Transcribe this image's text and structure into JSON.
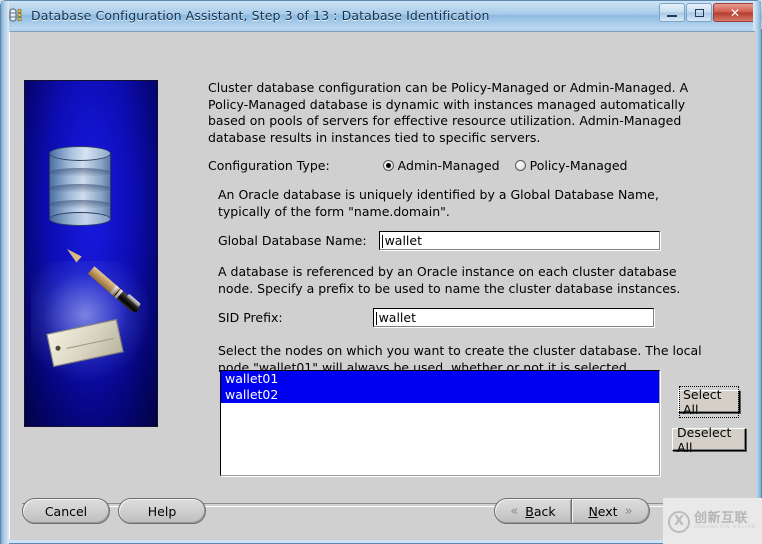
{
  "window": {
    "title": "Database Configuration Assistant, Step 3 of 13 : Database Identification",
    "app_icon": "database-icon",
    "minimize_label": "",
    "maximize_label": "",
    "close_label": "✕"
  },
  "sidebar": {
    "graphic_name": "database-pen-tag-illustration"
  },
  "main": {
    "intro_paragraph": "Cluster database configuration can be Policy-Managed or Admin-Managed. A Policy-Managed database is dynamic with instances managed automatically based on pools of servers for effective resource utilization. Admin-Managed database results in instances tied to specific servers.",
    "config_type_label": "Configuration Type:",
    "config_type_options": [
      {
        "label": "Admin-Managed",
        "selected": true
      },
      {
        "label": "Policy-Managed",
        "selected": false
      }
    ],
    "global_db_paragraph": "An Oracle database is uniquely identified by a Global Database Name, typically of the form \"name.domain\".",
    "global_db_label": "Global Database Name:",
    "global_db_value": "wallet",
    "sid_paragraph": "A database is referenced by an Oracle instance on each cluster database node. Specify a prefix to be used to name the cluster database instances.",
    "sid_label": "SID Prefix:",
    "sid_value": "wallet",
    "nodes_paragraph": "Select the nodes on which you want to create the cluster database. The local node \"wallet01\" will always be used, whether or not it is selected.",
    "node_list": [
      {
        "label": "wallet01",
        "selected": true
      },
      {
        "label": "wallet02",
        "selected": true
      }
    ],
    "select_all_label": "Select All",
    "deselect_all_label": "Deselect All"
  },
  "footer": {
    "cancel_label": "Cancel",
    "help_label": "Help",
    "back_label": "Back",
    "back_mnemonic": "B",
    "back_rest": "ack",
    "next_label": "Next",
    "next_mnemonic": "N",
    "next_rest": "ext",
    "back_chevron": "«",
    "next_chevron": "»"
  },
  "watermark": {
    "mark": "X",
    "cn_text": "创新互联",
    "en_text": "CHUANGXIN HULIAN"
  },
  "colors": {
    "selection_blue": "#0000f0",
    "panel_gray": "#d0d0d0",
    "title_blue": "#8fbbe2",
    "close_red": "#c0392b"
  }
}
